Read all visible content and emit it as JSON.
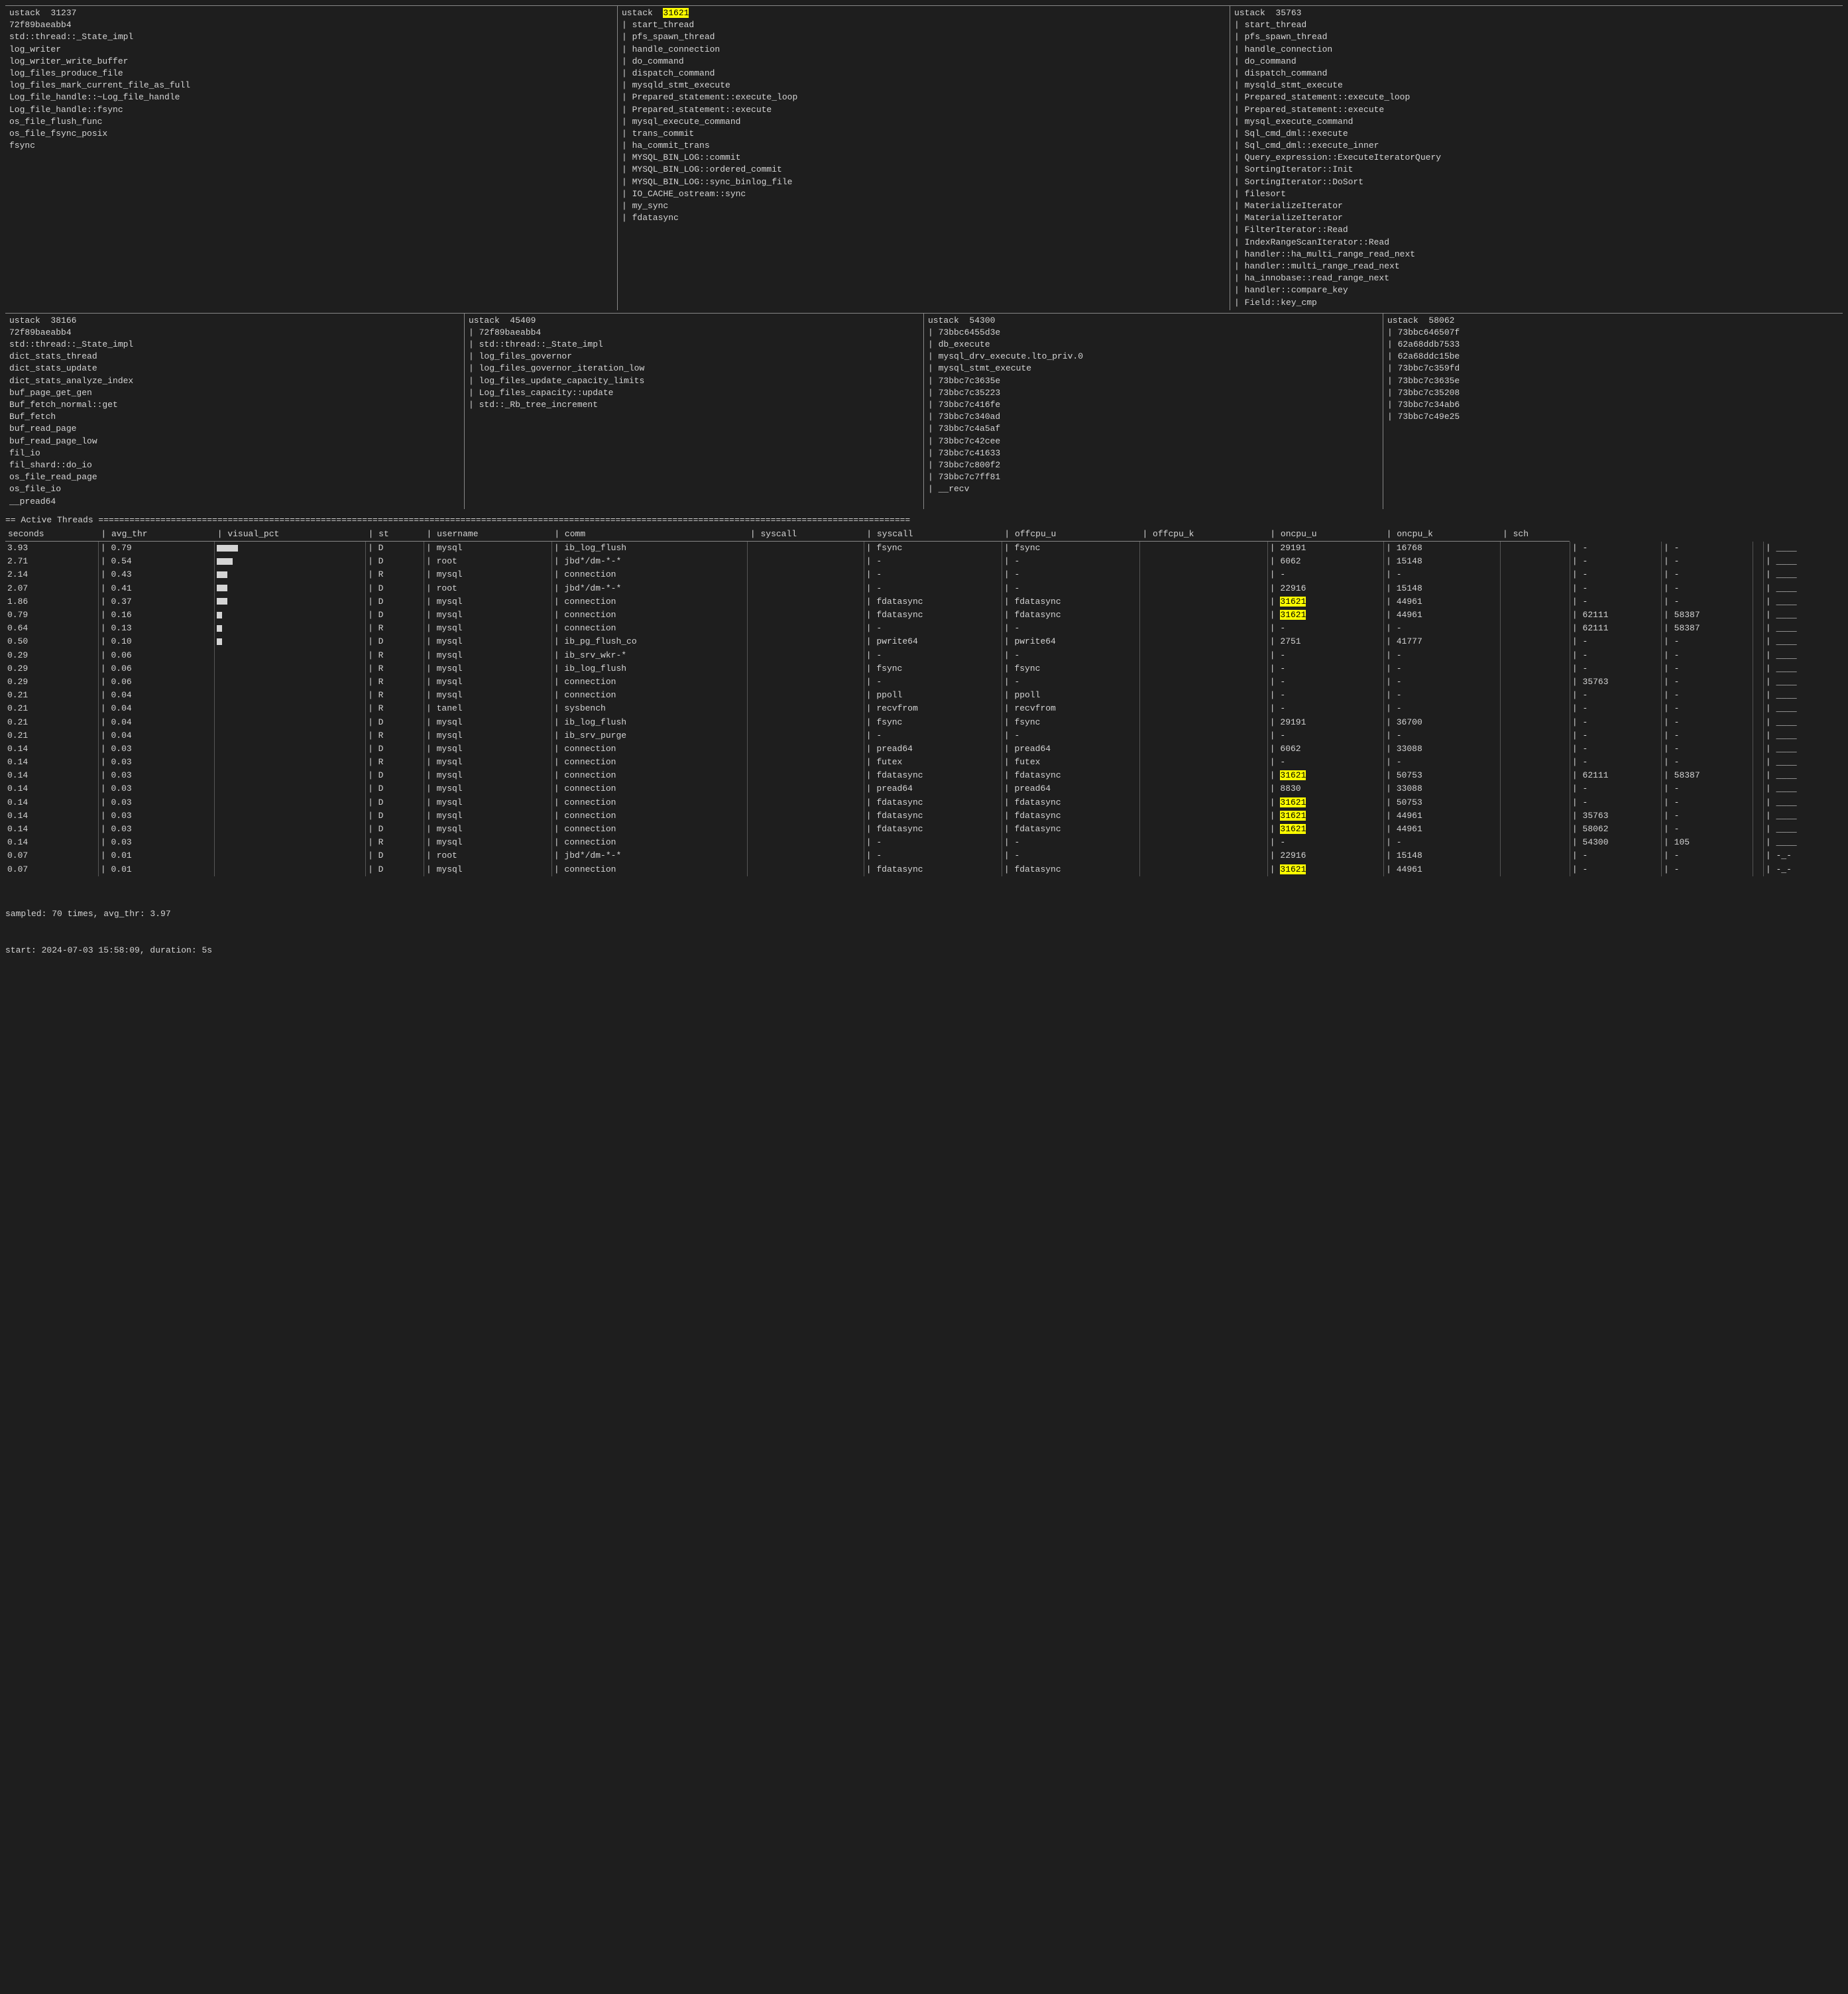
{
  "stacks_top": [
    {
      "id": "ustack_31237",
      "header": "ustack  31237",
      "lines": [
        "72f89baeabb4",
        "std::thread::_State_impl",
        "log_writer",
        "log_writer_write_buffer",
        "log_files_produce_file",
        "log_files_mark_current_file_as_full",
        "Log_file_handle::~Log_file_handle",
        "Log_file_handle::fsync",
        "os_file_flush_func",
        "os_file_fsync_posix",
        "fsync"
      ]
    },
    {
      "id": "ustack_31621",
      "header": "ustack  31621",
      "header_highlight": "31621",
      "lines": [
        "start_thread",
        "pfs_spawn_thread",
        "handle_connection",
        "do_command",
        "dispatch_command",
        "mysqld_stmt_execute",
        "Prepared_statement::execute_loop",
        "Prepared_statement::execute",
        "mysql_execute_command",
        "trans_commit",
        "ha_commit_trans",
        "MYSQL_BIN_LOG::commit",
        "MYSQL_BIN_LOG::ordered_commit",
        "MYSQL_BIN_LOG::sync_binlog_file",
        "IO_CACHE_ostream::sync",
        "my_sync",
        "fdatasync"
      ]
    },
    {
      "id": "ustack_35763",
      "header": "ustack  35763",
      "lines": [
        "start_thread",
        "pfs_spawn_thread",
        "handle_connection",
        "do_command",
        "dispatch_command",
        "mysqld_stmt_execute",
        "Prepared_statement::execute_loop",
        "Prepared_statement::execute",
        "mysql_execute_command",
        "Sql_cmd_dml::execute",
        "Sql_cmd_dml::execute_inner",
        "Query_expression::ExecuteIteratorQuery",
        "SortingIterator::Init",
        "SortingIterator::DoSort",
        "filesort",
        "MaterializeIterator",
        "MaterializeIterator",
        "FilterIterator::Read",
        "IndexRangeScanIterator::Read",
        "handler::ha_multi_range_read_next",
        "handler::multi_range_read_next",
        "ha_innobase::read_range_next",
        "handler::compare_key",
        "Field::key_cmp"
      ]
    }
  ],
  "stacks_bottom": [
    {
      "id": "ustack_38166",
      "header": "ustack  38166",
      "lines": [
        "72f89baeabb4",
        "std::thread::_State_impl",
        "dict_stats_thread",
        "dict_stats_update",
        "dict_stats_analyze_index",
        "buf_page_get_gen",
        "Buf_fetch_normal::get",
        "Buf_fetch",
        "buf_read_page",
        "buf_read_page_low",
        "fil_io",
        "fil_shard::do_io",
        "os_file_read_page",
        "os_file_io",
        "__pread64"
      ]
    },
    {
      "id": "ustack_45409",
      "header": "ustack  45409",
      "lines": [
        "72f89baeabb4",
        "std::thread::_State_impl",
        "log_files_governor",
        "log_files_governor_iteration_low",
        "log_files_update_capacity_limits",
        "Log_files_capacity::update",
        "std::_Rb_tree_increment"
      ]
    },
    {
      "id": "ustack_54300",
      "header": "ustack  54300",
      "lines": [
        "73bbc6455d3e",
        "db_execute",
        "mysql_drv_execute.lto_priv.0",
        "mysql_stmt_execute",
        "73bbc7c3635e",
        "73bbc7c35223",
        "73bbc7c416fe",
        "73bbc7c340ad",
        "73bbc7c4a5af",
        "73bbc7c42cee",
        "73bbc7c41633",
        "73bbc7c800f2",
        "73bbc7c7ff81",
        "__recv"
      ]
    },
    {
      "id": "ustack_58062",
      "header": "ustack  58062",
      "lines": [
        "73bbc646507f",
        "62a68ddb7533",
        "62a68ddc15be",
        "73bbc7c359fd",
        "73bbc7c3635e",
        "73bbc7c35208",
        "73bbc7c34ab6",
        "73bbc7c49e25"
      ]
    }
  ],
  "threads_section_header": "== Active Threads =============================================================================================================================================================",
  "threads_col_headers": [
    "seconds",
    "avg_thr",
    "visual_pct",
    "st",
    "username",
    "comm",
    "syscall",
    "syscall",
    "offcpu_u",
    "offcpu_k",
    "oncpu_u",
    "oncpu_k",
    "sch"
  ],
  "threads": [
    {
      "seconds": "3.93",
      "avg_thr": "0.79",
      "bar": 4,
      "st": "D",
      "username": "mysql",
      "comm": "ib_log_flush",
      "syscall1": "fsync",
      "syscall2": "fsync",
      "offcpu_u": "29191",
      "offcpu_k": "16768",
      "oncpu_u": "-",
      "oncpu_k": "-",
      "sch": "____"
    },
    {
      "seconds": "2.71",
      "avg_thr": "0.54",
      "bar": 3,
      "st": "D",
      "username": "root",
      "comm": "jbd*/dm-*-*",
      "syscall1": "-",
      "syscall2": "-",
      "offcpu_u": "6062",
      "offcpu_k": "15148",
      "oncpu_u": "-",
      "oncpu_k": "-",
      "sch": "____"
    },
    {
      "seconds": "2.14",
      "avg_thr": "0.43",
      "bar": 2,
      "st": "R",
      "username": "mysql",
      "comm": "connection",
      "syscall1": "-",
      "syscall2": "-",
      "offcpu_u": "-",
      "offcpu_k": "-",
      "oncpu_u": "-",
      "oncpu_k": "-",
      "sch": "____"
    },
    {
      "seconds": "2.07",
      "avg_thr": "0.41",
      "bar": 2,
      "st": "D",
      "username": "root",
      "comm": "jbd*/dm-*-*",
      "syscall1": "-",
      "syscall2": "-",
      "offcpu_u": "22916",
      "offcpu_k": "15148",
      "oncpu_u": "-",
      "oncpu_k": "-",
      "sch": "____"
    },
    {
      "seconds": "1.86",
      "avg_thr": "0.37",
      "bar": 2,
      "st": "D",
      "username": "mysql",
      "comm": "connection",
      "syscall1": "fdatasync",
      "syscall2": "fdatasync",
      "offcpu_u": "31621_hl",
      "offcpu_k": "44961",
      "oncpu_u": "-",
      "oncpu_k": "-",
      "sch": "____"
    },
    {
      "seconds": "0.79",
      "avg_thr": "0.16",
      "bar": 1,
      "st": "D",
      "username": "mysql",
      "comm": "connection",
      "syscall1": "fdatasync",
      "syscall2": "fdatasync",
      "offcpu_u": "31621_hl",
      "offcpu_k": "44961",
      "oncpu_u": "62111",
      "oncpu_k": "58387",
      "sch": "____"
    },
    {
      "seconds": "0.64",
      "avg_thr": "0.13",
      "bar": 1,
      "st": "R",
      "username": "mysql",
      "comm": "connection",
      "syscall1": "-",
      "syscall2": "-",
      "offcpu_u": "-",
      "offcpu_k": "-",
      "oncpu_u": "62111",
      "oncpu_k": "58387",
      "sch": "____"
    },
    {
      "seconds": "0.50",
      "avg_thr": "0.10",
      "bar": 1,
      "st": "D",
      "username": "mysql",
      "comm": "ib_pg_flush_co",
      "syscall1": "pwrite64",
      "syscall2": "pwrite64",
      "offcpu_u": "2751",
      "offcpu_k": "41777",
      "oncpu_u": "-",
      "oncpu_k": "-",
      "sch": "____"
    },
    {
      "seconds": "0.29",
      "avg_thr": "0.06",
      "bar": 0,
      "st": "R",
      "username": "mysql",
      "comm": "ib_srv_wkr-*",
      "syscall1": "-",
      "syscall2": "-",
      "offcpu_u": "-",
      "offcpu_k": "-",
      "oncpu_u": "-",
      "oncpu_k": "-",
      "sch": "____"
    },
    {
      "seconds": "0.29",
      "avg_thr": "0.06",
      "bar": 0,
      "st": "R",
      "username": "mysql",
      "comm": "ib_log_flush",
      "syscall1": "fsync",
      "syscall2": "fsync",
      "offcpu_u": "-",
      "offcpu_k": "-",
      "oncpu_u": "-",
      "oncpu_k": "-",
      "sch": "____"
    },
    {
      "seconds": "0.29",
      "avg_thr": "0.06",
      "bar": 0,
      "st": "R",
      "username": "mysql",
      "comm": "connection",
      "syscall1": "-",
      "syscall2": "-",
      "offcpu_u": "-",
      "offcpu_k": "-",
      "oncpu_u": "35763",
      "oncpu_k": "-",
      "sch": "____"
    },
    {
      "seconds": "0.21",
      "avg_thr": "0.04",
      "bar": 0,
      "st": "R",
      "username": "mysql",
      "comm": "connection",
      "syscall1": "ppoll",
      "syscall2": "ppoll",
      "offcpu_u": "-",
      "offcpu_k": "-",
      "oncpu_u": "-",
      "oncpu_k": "-",
      "sch": "____"
    },
    {
      "seconds": "0.21",
      "avg_thr": "0.04",
      "bar": 0,
      "st": "R",
      "username": "tanel",
      "comm": "sysbench",
      "syscall1": "recvfrom",
      "syscall2": "recvfrom",
      "offcpu_u": "-",
      "offcpu_k": "-",
      "oncpu_u": "-",
      "oncpu_k": "-",
      "sch": "____"
    },
    {
      "seconds": "0.21",
      "avg_thr": "0.04",
      "bar": 0,
      "st": "D",
      "username": "mysql",
      "comm": "ib_log_flush",
      "syscall1": "fsync",
      "syscall2": "fsync",
      "offcpu_u": "29191",
      "offcpu_k": "36700",
      "oncpu_u": "-",
      "oncpu_k": "-",
      "sch": "____"
    },
    {
      "seconds": "0.21",
      "avg_thr": "0.04",
      "bar": 0,
      "st": "R",
      "username": "mysql",
      "comm": "ib_srv_purge",
      "syscall1": "-",
      "syscall2": "-",
      "offcpu_u": "-",
      "offcpu_k": "-",
      "oncpu_u": "-",
      "oncpu_k": "-",
      "sch": "____"
    },
    {
      "seconds": "0.14",
      "avg_thr": "0.03",
      "bar": 0,
      "st": "D",
      "username": "mysql",
      "comm": "connection",
      "syscall1": "pread64",
      "syscall2": "pread64",
      "offcpu_u": "6062",
      "offcpu_k": "33088",
      "oncpu_u": "-",
      "oncpu_k": "-",
      "sch": "____"
    },
    {
      "seconds": "0.14",
      "avg_thr": "0.03",
      "bar": 0,
      "st": "R",
      "username": "mysql",
      "comm": "connection",
      "syscall1": "futex",
      "syscall2": "futex",
      "offcpu_u": "-",
      "offcpu_k": "-",
      "oncpu_u": "-",
      "oncpu_k": "-",
      "sch": "____"
    },
    {
      "seconds": "0.14",
      "avg_thr": "0.03",
      "bar": 0,
      "st": "D",
      "username": "mysql",
      "comm": "connection",
      "syscall1": "fdatasync",
      "syscall2": "fdatasync",
      "offcpu_u": "31621_hl",
      "offcpu_k": "50753",
      "oncpu_u": "62111",
      "oncpu_k": "58387",
      "sch": "____"
    },
    {
      "seconds": "0.14",
      "avg_thr": "0.03",
      "bar": 0,
      "st": "D",
      "username": "mysql",
      "comm": "connection",
      "syscall1": "pread64",
      "syscall2": "pread64",
      "offcpu_u": "8830",
      "offcpu_k": "33088",
      "oncpu_u": "-",
      "oncpu_k": "-",
      "sch": "____"
    },
    {
      "seconds": "0.14",
      "avg_thr": "0.03",
      "bar": 0,
      "st": "D",
      "username": "mysql",
      "comm": "connection",
      "syscall1": "fdatasync",
      "syscall2": "fdatasync",
      "offcpu_u": "31621_hl",
      "offcpu_k": "50753",
      "oncpu_u": "-",
      "oncpu_k": "-",
      "sch": "____"
    },
    {
      "seconds": "0.14",
      "avg_thr": "0.03",
      "bar": 0,
      "st": "D",
      "username": "mysql",
      "comm": "connection",
      "syscall1": "fdatasync",
      "syscall2": "fdatasync",
      "offcpu_u": "31621_hl",
      "offcpu_k": "44961",
      "oncpu_u": "35763",
      "oncpu_k": "-",
      "sch": "____"
    },
    {
      "seconds": "0.14",
      "avg_thr": "0.03",
      "bar": 0,
      "st": "D",
      "username": "mysql",
      "comm": "connection",
      "syscall1": "fdatasync",
      "syscall2": "fdatasync",
      "offcpu_u": "31621_hl",
      "offcpu_k": "44961",
      "oncpu_u": "58062",
      "oncpu_k": "-",
      "sch": "____"
    },
    {
      "seconds": "0.14",
      "avg_thr": "0.03",
      "bar": 0,
      "st": "R",
      "username": "mysql",
      "comm": "connection",
      "syscall1": "-",
      "syscall2": "-",
      "offcpu_u": "-",
      "offcpu_k": "-",
      "oncpu_u": "54300",
      "oncpu_k": "105",
      "sch": "____"
    },
    {
      "seconds": "0.07",
      "avg_thr": "0.01",
      "bar": 0,
      "st": "D",
      "username": "root",
      "comm": "jbd*/dm-*-*",
      "syscall1": "-",
      "syscall2": "-",
      "offcpu_u": "22916",
      "offcpu_k": "15148",
      "oncpu_u": "-",
      "oncpu_k": "-",
      "sch": "-_-"
    },
    {
      "seconds": "0.07",
      "avg_thr": "0.01",
      "bar": 0,
      "st": "D",
      "username": "mysql",
      "comm": "connection",
      "syscall1": "fdatasync",
      "syscall2": "fdatasync",
      "offcpu_u": "31621_hl",
      "offcpu_k": "44961",
      "oncpu_u": "-",
      "oncpu_k": "-",
      "sch": "-_-"
    }
  ],
  "footer": {
    "sampled": "sampled: 70 times, avg_thr: 3.97",
    "start": "start: 2024-07-03 15:58:09, duration: 5s"
  }
}
